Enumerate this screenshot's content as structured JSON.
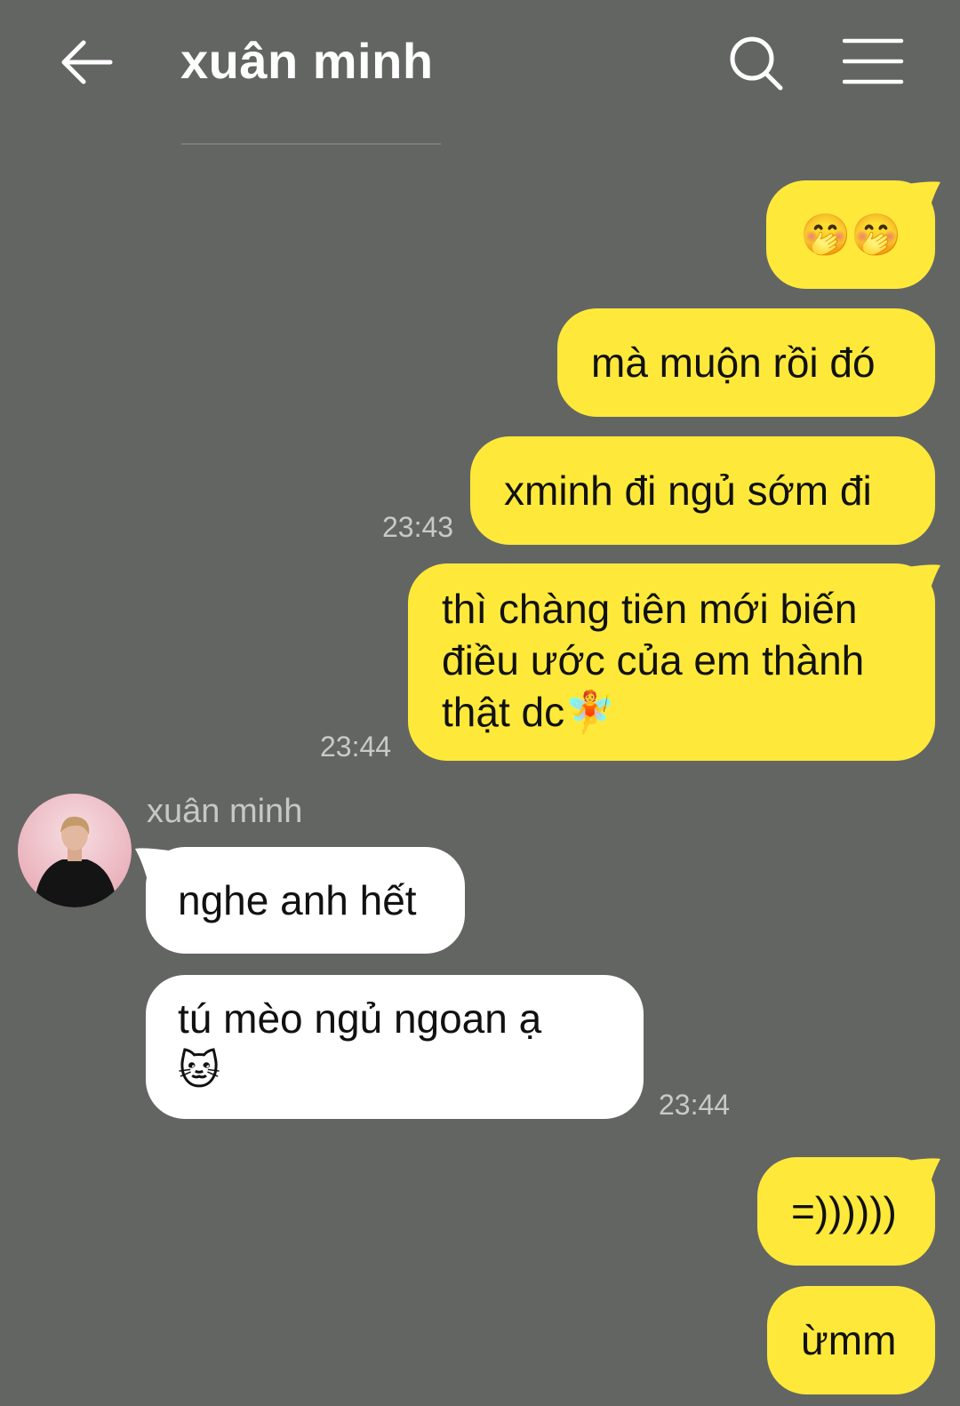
{
  "header": {
    "title": "xuân minh",
    "back_icon": "arrow-left-icon",
    "search_icon": "search-icon",
    "menu_icon": "hamburger-menu-icon"
  },
  "colors": {
    "background": "#636563",
    "outgoing_bubble": "#fee93a",
    "incoming_bubble": "#ffffff",
    "timestamp": "#c8c9c8"
  },
  "messages": [
    {
      "direction": "out",
      "text": "🤭🤭"
    },
    {
      "direction": "out",
      "text": "mà muộn rồi đó"
    },
    {
      "direction": "out",
      "text": "xminh đi ngủ sớm đi",
      "time": "23:43"
    },
    {
      "direction": "out",
      "lines": [
        "thì chàng tiên mới biến",
        "điều ước của em thành",
        "thật dc🧚"
      ],
      "time": "23:44"
    },
    {
      "direction": "in",
      "sender": "xuân minh",
      "text": "nghe anh hết"
    },
    {
      "direction": "in",
      "lines": [
        "tú mèo ngủ ngoan ạ",
        "🐱"
      ],
      "time": "23:44"
    },
    {
      "direction": "out",
      "text": "=))))))"
    },
    {
      "direction": "out",
      "text": "ừmm"
    }
  ]
}
